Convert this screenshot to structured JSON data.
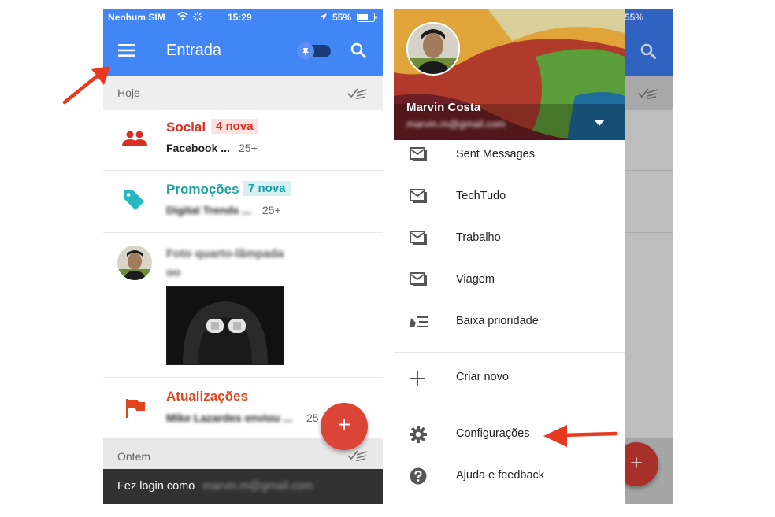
{
  "left": {
    "status": {
      "carrier": "Nenhum SIM",
      "time": "15:29",
      "battery": "55%"
    },
    "appbar": {
      "title": "Entrada"
    },
    "sections": {
      "today": "Hoje",
      "yesterday": "Ontem"
    },
    "social": {
      "title": "Social",
      "badge": "4 nova",
      "snippet": "Facebook ...",
      "count": "25+"
    },
    "promos": {
      "title": "Promoções",
      "badge": "7 nova",
      "snippet": "Digital Trends ...",
      "count": "25+"
    },
    "message": {
      "subject": "Foto quarto-lâmpada",
      "line2": "oo"
    },
    "updates": {
      "title": "Atualizações",
      "snippet": "Mike Lazardes enviou ...",
      "count": "25"
    },
    "fab": "+",
    "snackbar": {
      "text": "Fez login como",
      "email": "marvin.m@gmail.com"
    }
  },
  "right": {
    "status": {
      "battery": "55%"
    },
    "account": {
      "name": "Marvin Costa",
      "email": "marvin.m@gmail.com"
    },
    "items": [
      {
        "label": "Sent Messages"
      },
      {
        "label": "TechTudo"
      },
      {
        "label": "Trabalho"
      },
      {
        "label": "Viagem"
      },
      {
        "label": "Baixa prioridade"
      }
    ],
    "create": "Criar novo",
    "settings": "Configurações",
    "help": "Ajuda e feedback",
    "fab": "+"
  },
  "colors": {
    "appbar": "#4285f4",
    "social": "#d93025",
    "promos": "#1a9fa6",
    "updates": "#e2451d",
    "fab": "#db4437",
    "arrow": "#e8381f"
  }
}
